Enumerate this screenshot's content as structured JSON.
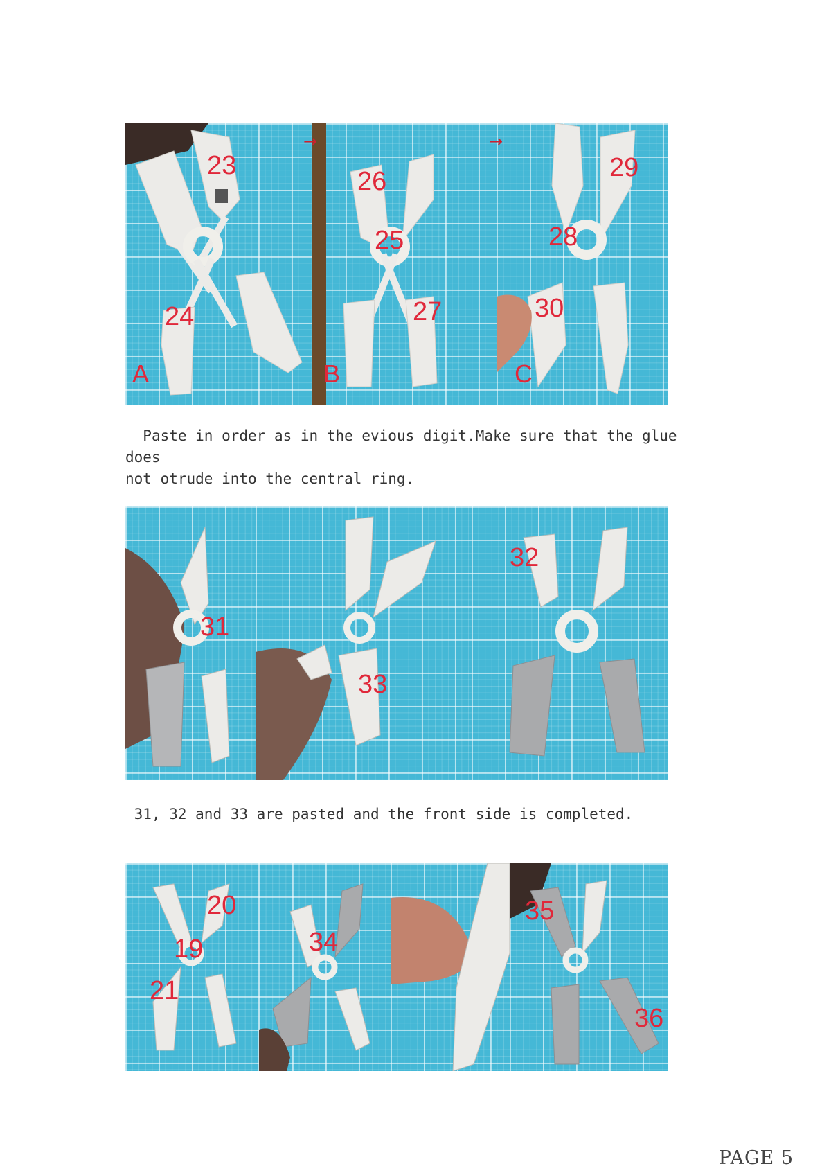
{
  "photos": {
    "row1": {
      "panels": [
        {
          "letter": "A",
          "labels": [
            "23",
            "24"
          ]
        },
        {
          "letter": "B",
          "labels": [
            "26",
            "25",
            "27"
          ]
        },
        {
          "letter": "C",
          "labels": [
            "29",
            "28",
            "30"
          ]
        }
      ],
      "arrow_symbol": "→"
    },
    "row2": {
      "panels": [
        {
          "labels": [
            "31"
          ]
        },
        {
          "labels": [
            "33"
          ]
        },
        {
          "labels": [
            "32"
          ]
        }
      ]
    },
    "row3": {
      "panels": [
        {
          "labels": [
            "20",
            "19",
            "21"
          ]
        },
        {
          "labels": [
            "34"
          ]
        },
        {
          "labels": []
        },
        {
          "labels": [
            "35",
            "36"
          ]
        }
      ]
    }
  },
  "captions": {
    "step1": "  Paste in order as in the evious digit.Make sure that the glue does\nnot otrude into the central ring.",
    "step2": " 31, 32 and 33 are pasted and the front side is completed."
  },
  "footer": {
    "page_number": "PAGE 5"
  },
  "colors": {
    "label_red": "#e0283a",
    "mat_blue": "#45b8d6",
    "part_white": "#ecebe8",
    "part_grey": "#9a9b9d"
  }
}
